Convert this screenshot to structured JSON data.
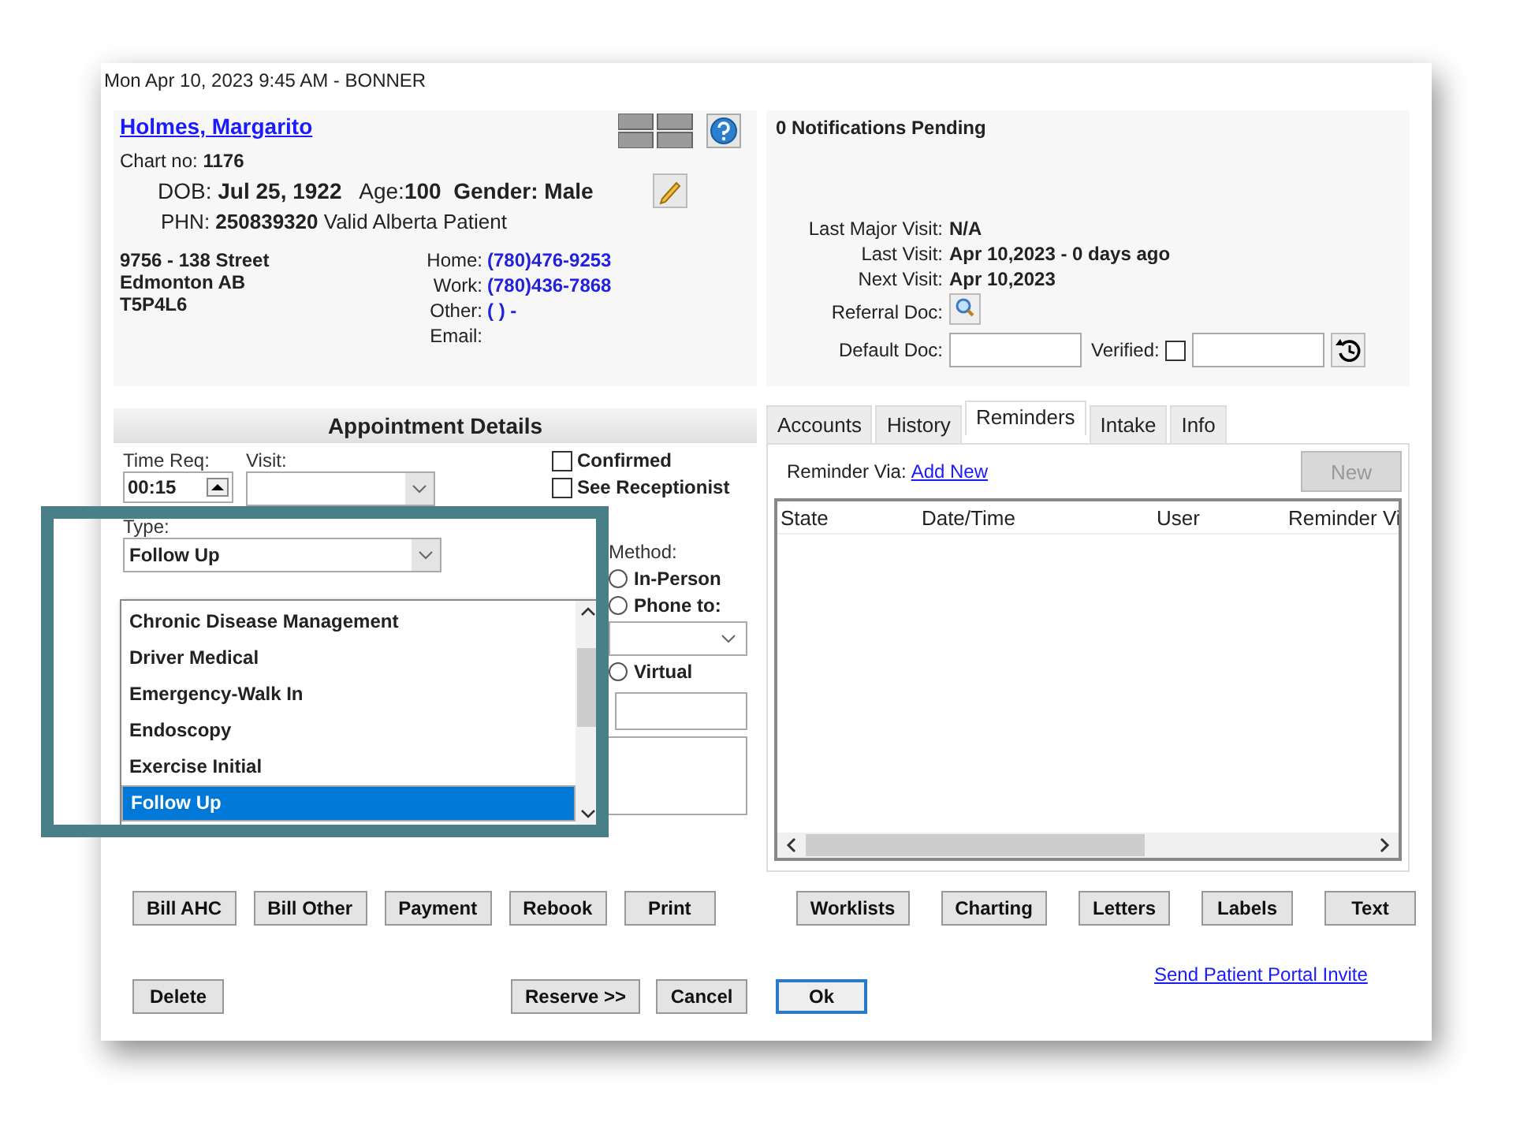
{
  "header": "Mon Apr 10, 2023  9:45 AM - BONNER",
  "patient": {
    "name": "Holmes, Margarito",
    "chart_label": "Chart no:",
    "chart_no": "1176",
    "dob_label": "DOB:",
    "dob": "Jul 25, 1922",
    "age_label": "Age:",
    "age": "100",
    "gender": "Gender: Male",
    "phn_label": "PHN:",
    "phn": "250839320",
    "phn_status": "Valid Alberta Patient",
    "address": [
      "9756 - 138 Street",
      "Edmonton  AB",
      "T5P4L6"
    ],
    "contacts": [
      {
        "label": "Home:",
        "value": "(780)476-9253"
      },
      {
        "label": "Work:",
        "value": "(780)436-7868"
      },
      {
        "label": "Other:",
        "value": "(  )  -"
      },
      {
        "label": "Email:"
      }
    ]
  },
  "notifications": "0 Notifications Pending",
  "visits": [
    {
      "label": "Last Major Visit:",
      "value": "N/A"
    },
    {
      "label": "Last Visit:",
      "value": "Apr 10,2023 - 0 days ago"
    },
    {
      "label": "Next Visit:",
      "value": "Apr 10,2023"
    }
  ],
  "referral_doc_label": "Referral Doc:",
  "default_doc_label": "Default Doc:",
  "verified": {
    "label": "Verified:",
    "checked": false
  },
  "appointment": {
    "title": "Appointment Details",
    "time_label": "Time Req:",
    "time": "00:15",
    "visit_label": "Visit:",
    "checkboxes": [
      {
        "label": "Confirmed",
        "checked": false
      },
      {
        "label": "See Receptionist",
        "checked": false
      }
    ],
    "type_label": "Type:",
    "type_value": "Follow Up",
    "type_options": [
      {
        "label": "Chronic Disease Management",
        "selected": false
      },
      {
        "label": "Driver Medical",
        "selected": false
      },
      {
        "label": "Emergency-Walk In",
        "selected": false
      },
      {
        "label": "Endoscopy",
        "selected": false
      },
      {
        "label": "Exercise Initial",
        "selected": false
      },
      {
        "label": "Follow Up",
        "selected": true
      }
    ],
    "method_label": "Method:",
    "methods": [
      {
        "label": "In-Person",
        "kind": "radio",
        "selected": false
      },
      {
        "label": "Phone to:",
        "kind": "radio-select",
        "selected": false
      },
      {
        "label": "Virtual",
        "kind": "radio",
        "selected": false
      }
    ]
  },
  "tabs": [
    {
      "label": "Accounts",
      "selected": false
    },
    {
      "label": "History",
      "selected": false
    },
    {
      "label": "Reminders",
      "selected": true
    },
    {
      "label": "Intake",
      "selected": false
    },
    {
      "label": "Info",
      "selected": false
    }
  ],
  "reminders": {
    "via_label": "Reminder Via:",
    "add_link": "Add New",
    "new_button": {
      "label": "New",
      "disabled": true
    },
    "columns": [
      "State",
      "Date/Time",
      "User",
      "Reminder Vi"
    ]
  },
  "left_buttons": [
    "Bill AHC",
    "Bill Other",
    "Payment",
    "Rebook",
    "Print"
  ],
  "right_buttons": [
    "Worklists",
    "Charting",
    "Letters",
    "Labels",
    "Text"
  ],
  "portal_link": "Send Patient Portal Invite",
  "bottom_buttons": [
    {
      "label": "Delete",
      "default": false
    },
    {
      "label": "Reserve >>",
      "default": false
    },
    {
      "label": "Cancel",
      "default": false
    },
    {
      "label": "Ok",
      "default": true
    }
  ]
}
